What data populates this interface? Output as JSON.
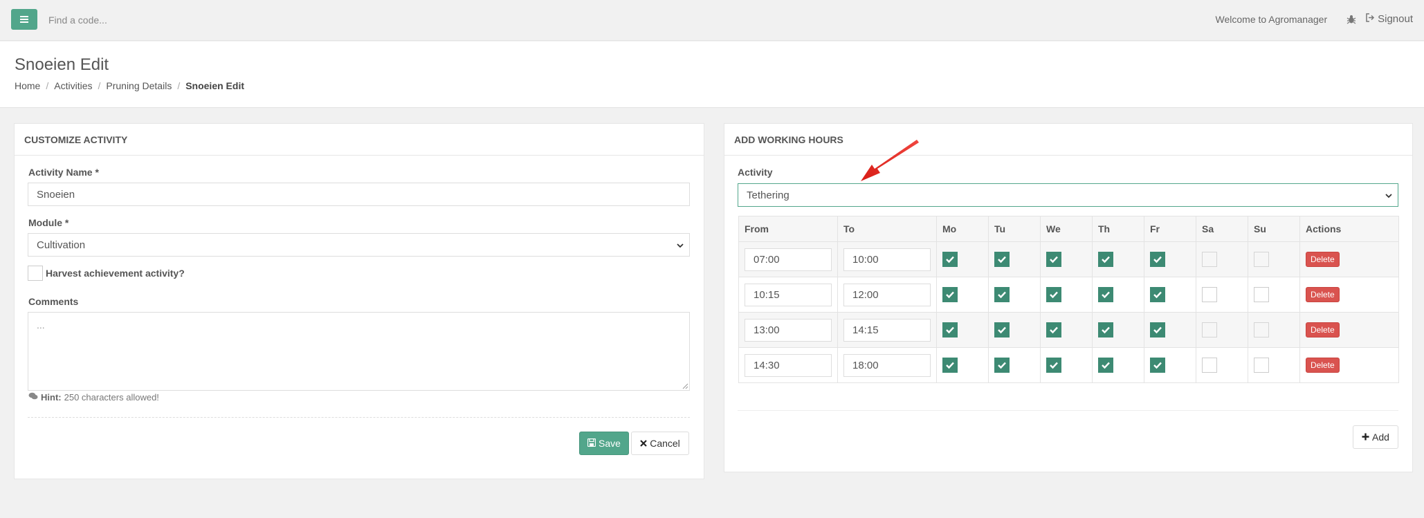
{
  "topbar": {
    "search_placeholder": "Find a code...",
    "welcome": "Welcome to Agromanager",
    "signout": "Signout"
  },
  "page": {
    "title": "Snoeien Edit",
    "breadcrumb": [
      "Home",
      "Activities",
      "Pruning Details",
      "Snoeien Edit"
    ]
  },
  "customize": {
    "heading": "CUSTOMIZE ACTIVITY",
    "activity_name_label": "Activity Name *",
    "activity_name_value": "Snoeien",
    "module_label": "Module *",
    "module_value": "Cultivation",
    "harvest_label": "Harvest achievement activity?",
    "comments_label": "Comments",
    "comments_placeholder": "...",
    "hint_label": "Hint:",
    "hint_text": "250 characters allowed!",
    "save_label": "Save",
    "cancel_label": "Cancel"
  },
  "working_hours": {
    "heading": "ADD WORKING HOURS",
    "activity_label": "Activity",
    "activity_value": "Tethering",
    "columns": [
      "From",
      "To",
      "Mo",
      "Tu",
      "We",
      "Th",
      "Fr",
      "Sa",
      "Su",
      "Actions"
    ],
    "rows": [
      {
        "from": "07:00",
        "to": "10:00",
        "days": [
          true,
          true,
          true,
          true,
          true,
          false,
          false
        ]
      },
      {
        "from": "10:15",
        "to": "12:00",
        "days": [
          true,
          true,
          true,
          true,
          true,
          false,
          false
        ]
      },
      {
        "from": "13:00",
        "to": "14:15",
        "days": [
          true,
          true,
          true,
          true,
          true,
          false,
          false
        ]
      },
      {
        "from": "14:30",
        "to": "18:00",
        "days": [
          true,
          true,
          true,
          true,
          true,
          false,
          false
        ]
      }
    ],
    "delete_label": "Delete",
    "add_label": "Add"
  },
  "colors": {
    "accent": "#52a68b",
    "check": "#3d8a73",
    "danger": "#d9534f",
    "arrow": "#e8261e"
  },
  "icons": [
    "bars-icon",
    "bug-icon",
    "signout-icon",
    "comments-icon",
    "save-icon",
    "times-icon",
    "plus-icon",
    "check-icon",
    "chevron-down-icon",
    "arrow-pointer"
  ]
}
